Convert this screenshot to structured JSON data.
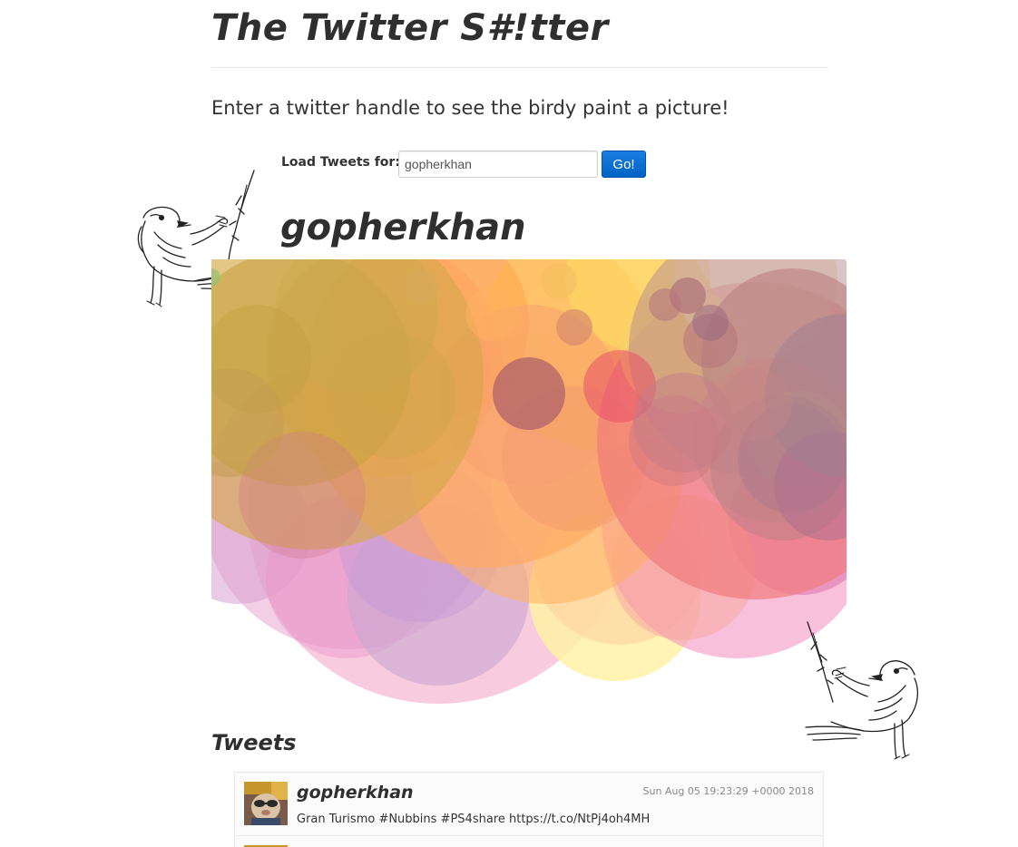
{
  "header": {
    "title": "The Twitter S#!tter"
  },
  "intro": {
    "text": "Enter a twitter handle to see the birdy paint a picture!"
  },
  "search": {
    "label": "Load Tweets for:",
    "value": "gopherkhan",
    "button_label": "Go!"
  },
  "result": {
    "handle": "gopherkhan"
  },
  "tweets": {
    "heading": "Tweets",
    "items": [
      {
        "user": "gopherkhan",
        "time": "Sun Aug 05 19:23:29 +0000 2018",
        "text": "Gran Turismo #Nubbins #PS4share https://t.co/NtPj4oh4MH"
      }
    ]
  },
  "colors": {
    "accent": "#0062c4",
    "text": "#333333",
    "divider": "#e6e6e6"
  },
  "icons": {
    "left_bird": "bird-on-branch-icon",
    "right_bird": "bird-on-branch-icon",
    "avatar": "avatar"
  }
}
